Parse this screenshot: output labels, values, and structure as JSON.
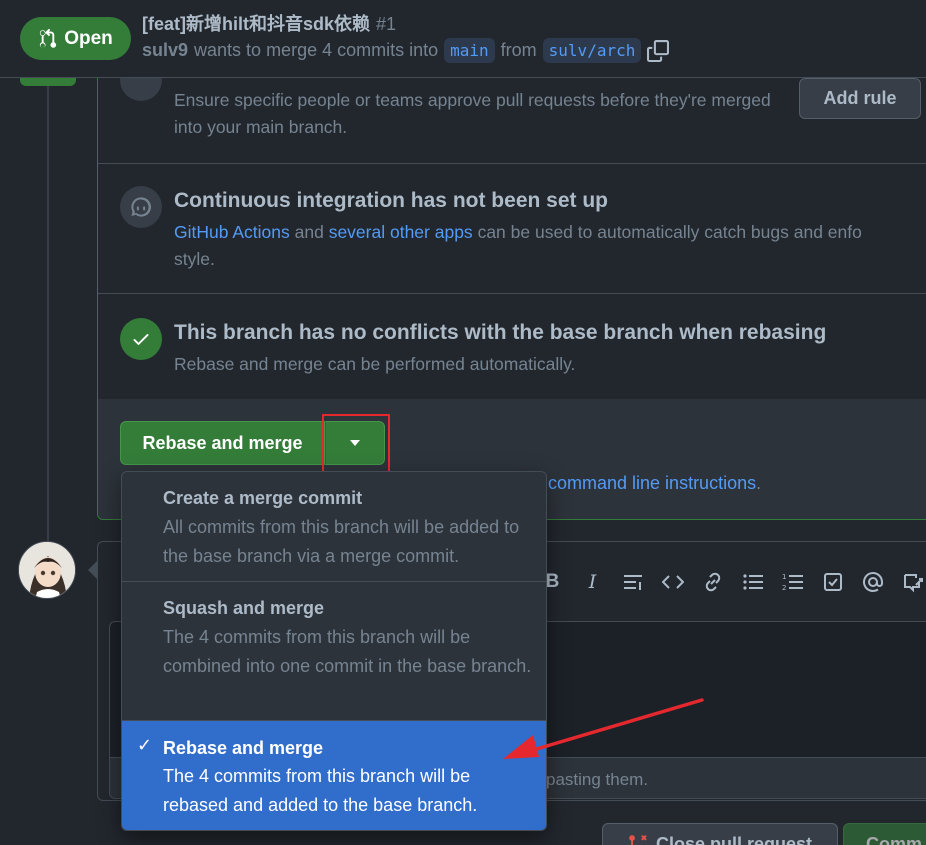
{
  "header": {
    "state": "Open",
    "title": "[feat]新增hilt和抖音sdk依赖",
    "number": "#1",
    "author": "sulv9",
    "merge_text": "wants to merge 4 commits into",
    "base_branch": "main",
    "from_text": "from",
    "head_branch": "sulv/arch"
  },
  "review_section": {
    "description": "Ensure specific people or teams approve pull requests before they're merged into your main branch.",
    "button": "Add rule"
  },
  "ci_section": {
    "title": "Continuous integration has not been set up",
    "link1": "GitHub Actions",
    "and_text": "and",
    "link2": "several other apps",
    "rest": "can be used to automatically catch bugs and enfo",
    "rest2": "style."
  },
  "conflict_section": {
    "title": "This branch has no conflicts with the base branch when rebasing",
    "description": "Rebase and merge can be performed automatically."
  },
  "merge_actions": {
    "button": "Rebase and merge",
    "cli_link": "command line instructions",
    "cli_suffix": "."
  },
  "merge_menu": {
    "items": [
      {
        "title": "Create a merge commit",
        "description": "All commits from this branch will be added to the base branch via a merge commit.",
        "selected": false
      },
      {
        "title": "Squash and merge",
        "description": "The 4 commits from this branch will be combined into one commit in the base branch.",
        "selected": false
      },
      {
        "title": "Rebase and merge",
        "description": "The 4 commits from this branch will be rebased and added to the base branch.",
        "selected": true
      }
    ]
  },
  "comment": {
    "attach_text": "pasting them.",
    "close_button": "Close pull request",
    "comment_button": "Comm"
  },
  "colors": {
    "open_green": "#347d39",
    "link_blue": "#539bf5",
    "selected_blue": "#316dca",
    "annotation_red": "#e5282e"
  }
}
